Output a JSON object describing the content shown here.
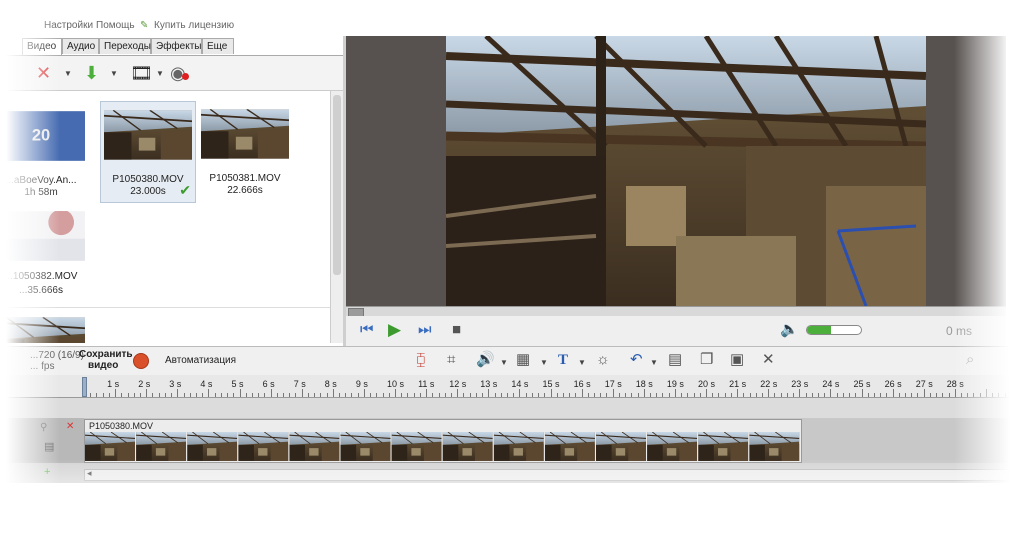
{
  "menu": {
    "settings": "Настройки",
    "help": "Помощь",
    "license": "Купить лицензию"
  },
  "tabs": [
    "Видео",
    "Аудио",
    "Переходы",
    "Эффекты",
    "Еще"
  ],
  "clips": [
    {
      "name": "...aBoeVoy.An...",
      "duration": "1h 58m"
    },
    {
      "name": "P1050380.MOV",
      "duration": "23.000s"
    },
    {
      "name": "P1050381.MOV",
      "duration": "22.666s"
    },
    {
      "name": "...1050382.MOV",
      "duration": "...35.666s"
    }
  ],
  "player": {
    "time": "0 ms",
    "volume": 0.45
  },
  "timeline_toolbar": {
    "project_info": "...720 (16/9)",
    "fps": "... fps",
    "save_label_1": "Сохранить",
    "save_label_2": "видео",
    "automation": "Автоматизация"
  },
  "ruler": [
    "1 s",
    "2 s",
    "3 s",
    "4 s",
    "5 s",
    "6 s",
    "7 s",
    "8 s",
    "9 s",
    "10 s",
    "11 s",
    "12 s",
    "13 s",
    "14 s",
    "15 s",
    "16 s",
    "17 s",
    "18 s",
    "19 s",
    "20 s",
    "21 s",
    "22 s",
    "23 s",
    "24 s",
    "25 s",
    "26 s",
    "27 s",
    "28 s"
  ],
  "timeline_clip": {
    "name": "P1050380.MOV"
  },
  "icons": [
    "delete-icon",
    "import-icon",
    "film-icon",
    "webcam-icon",
    "rewind-icon",
    "play-icon",
    "forward-icon",
    "stop-icon",
    "speaker-icon",
    "split-icon",
    "crop-icon",
    "audio-icon",
    "effects-icon",
    "text-icon",
    "brightness-icon",
    "undo-icon",
    "trim-icon",
    "copy-icon",
    "paste-icon",
    "cut-icon",
    "zoom-icon",
    "record-icon",
    "checkmark-icon"
  ],
  "colors": {
    "accent_green": "#4caf3b",
    "record_red": "#d9502a",
    "player_bg": "#57514f"
  }
}
